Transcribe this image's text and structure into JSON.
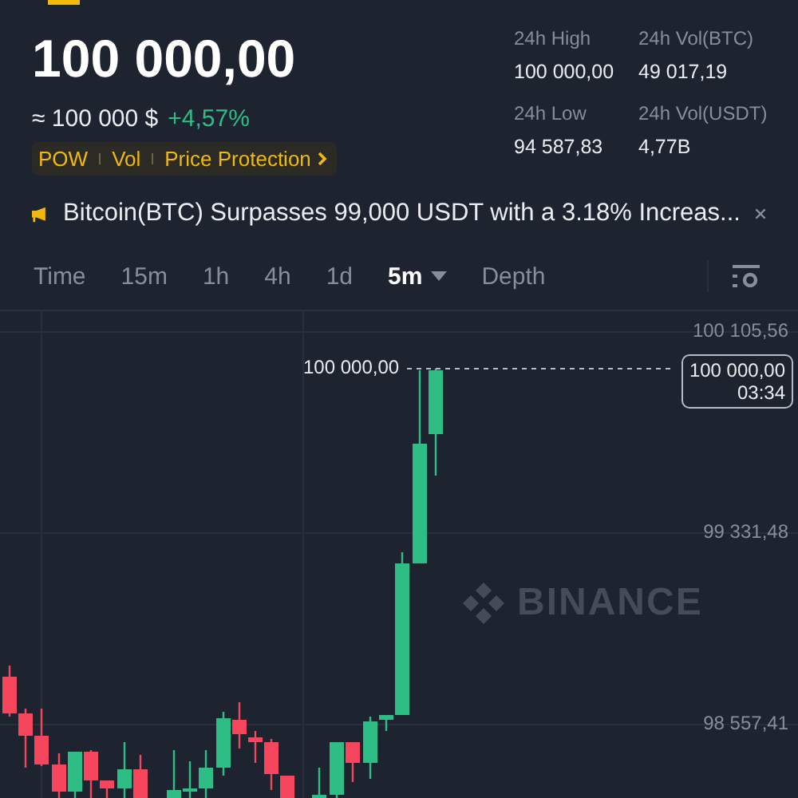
{
  "header": {
    "price": "100 000,00",
    "approx": "≈ 100 000 $",
    "change": "+4,57%",
    "tags": [
      "POW",
      "Vol",
      "Price Protection"
    ],
    "stats": [
      {
        "label": "24h High",
        "value": "100 000,00"
      },
      {
        "label": "24h Vol(BTC)",
        "value": "49 017,19"
      },
      {
        "label": "24h Low",
        "value": "94 587,83"
      },
      {
        "label": "24h Vol(USDT)",
        "value": "4,77B"
      }
    ]
  },
  "notice": {
    "text": "Bitcoin(BTC) Surpasses 99,000 USDT with a 3.18% Increas..."
  },
  "intervals": [
    {
      "label": "Time",
      "selected": false,
      "has_menu": false
    },
    {
      "label": "15m",
      "selected": false,
      "has_menu": false
    },
    {
      "label": "1h",
      "selected": false,
      "has_menu": false
    },
    {
      "label": "4h",
      "selected": false,
      "has_menu": false
    },
    {
      "label": "1d",
      "selected": false,
      "has_menu": false
    },
    {
      "label": "5m",
      "selected": true,
      "has_menu": true
    },
    {
      "label": "Depth",
      "selected": false,
      "has_menu": false
    }
  ],
  "chart": {
    "price_labels": [
      "100 105,56",
      "99 331,48",
      "98 557,41"
    ],
    "last_price": "100 000,00",
    "cursor_price": "100 000,00",
    "cursor_time": "03:34",
    "watermark": "BINANCE"
  }
}
